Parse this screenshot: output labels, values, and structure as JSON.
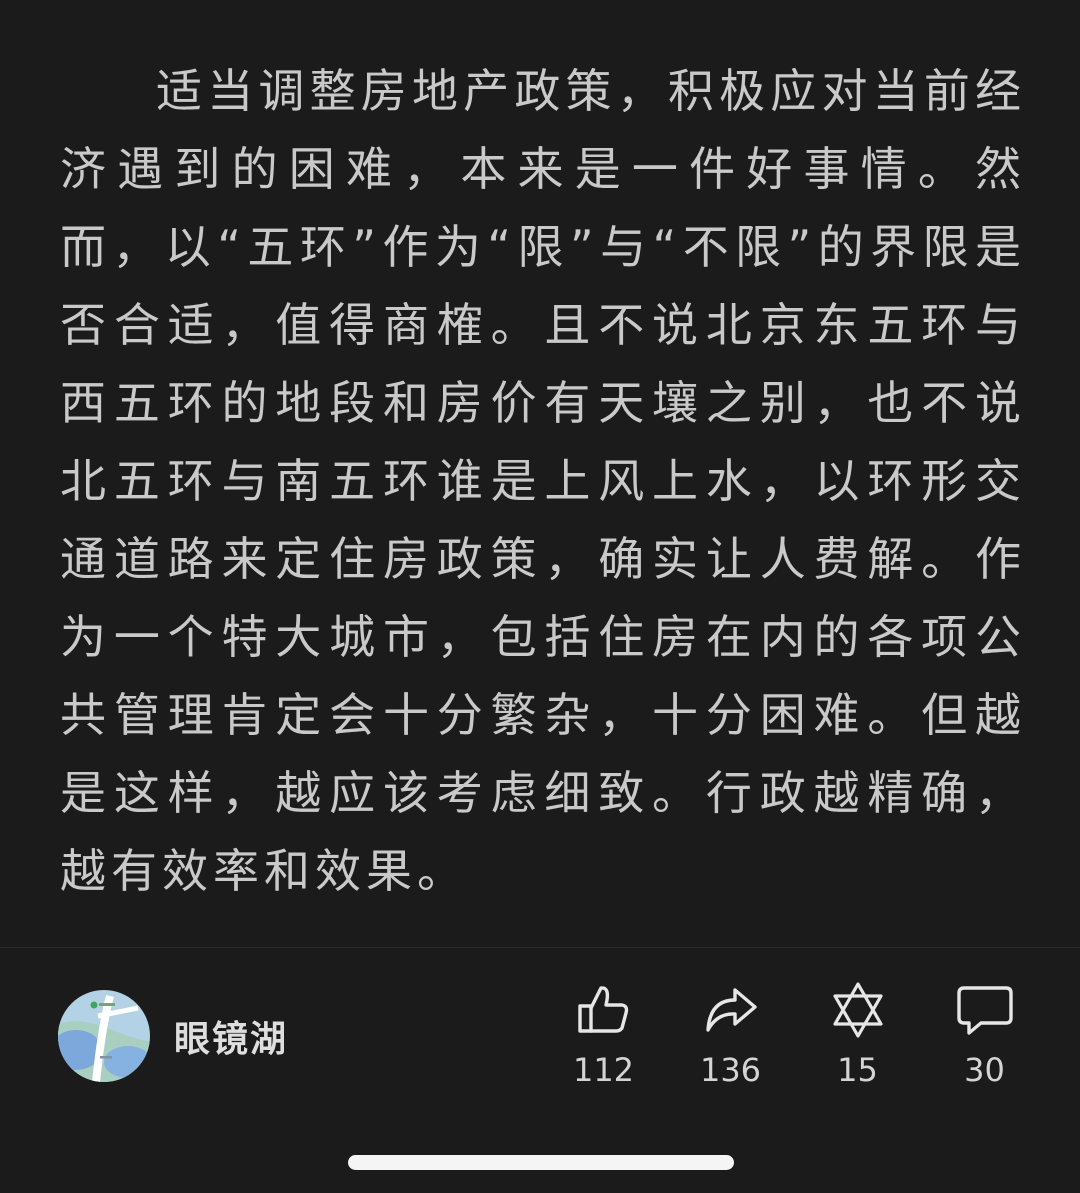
{
  "article": {
    "text": "适当调整房地产政策，积极应对当前经济遇到的困难，本来是一件好事情。然而，以“五环”作为“限”与“不限”的界限是否合适，值得商榷。且不说北京东五环与西五环的地段和房价有天壤之别，也不说北五环与南五环谁是上风上水，以环形交通道路来定住房政策，确实让人费解。作为一个特大城市，包括住房在内的各项公共管理肯定会十分繁杂，十分困难。但越是这样，越应该考虑细致。行政越精确，越有效率和效果。"
  },
  "author": {
    "name": "眼镜湖"
  },
  "actions": {
    "like": {
      "icon": "thumbs-up-icon",
      "count": "112"
    },
    "share": {
      "icon": "share-arrow-icon",
      "count": "136"
    },
    "favorite": {
      "icon": "star-of-david-icon",
      "count": "15"
    },
    "comment": {
      "icon": "comment-bubble-icon",
      "count": "30"
    }
  },
  "colors": {
    "background": "#1b1b1b",
    "body_text": "#c9c9c9",
    "icon_stroke": "#e6e6e6"
  }
}
